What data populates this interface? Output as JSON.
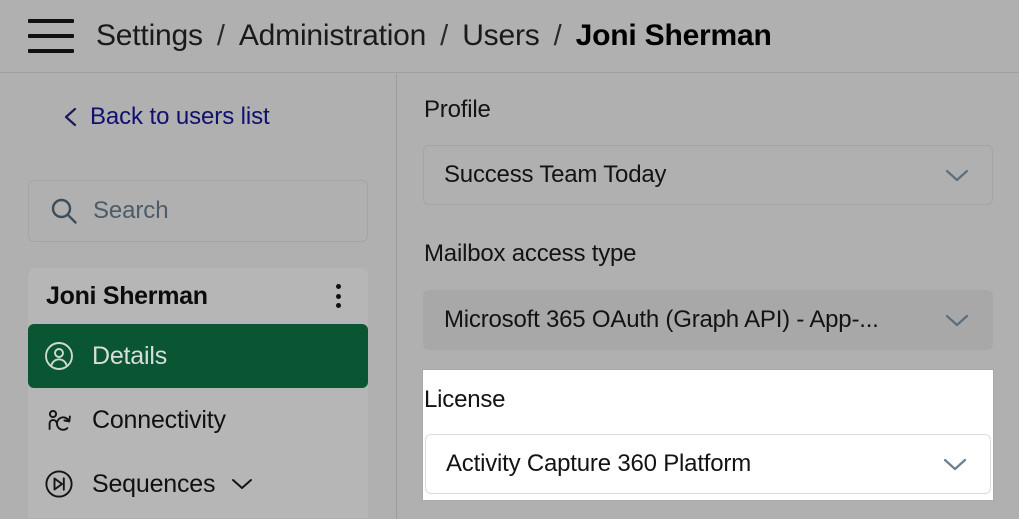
{
  "topbar": {
    "menu_icon": "hamburger-icon",
    "breadcrumbs": [
      {
        "label": "Settings",
        "current": false
      },
      {
        "label": "Administration",
        "current": false
      },
      {
        "label": "Users",
        "current": false
      },
      {
        "label": "Joni Sherman",
        "current": true
      }
    ],
    "separator": "/"
  },
  "sidebar": {
    "back_link": {
      "label": "Back to users list",
      "icon": "chevron-left-icon",
      "color": "#10106e"
    },
    "search": {
      "placeholder": "Search",
      "icon": "search-icon",
      "value": ""
    },
    "user": {
      "name": "Joni Sherman",
      "menu_icon": "kebab-menu-icon"
    },
    "nav_items": [
      {
        "label": "Details",
        "icon": "user-circle-icon",
        "active": true,
        "expandable": false
      },
      {
        "label": "Connectivity",
        "icon": "user-sync-icon",
        "active": false,
        "expandable": false
      },
      {
        "label": "Sequences",
        "icon": "play-skip-circle-icon",
        "active": false,
        "expandable": true
      }
    ],
    "active_color": "#0a5532"
  },
  "main": {
    "fields": [
      {
        "label": "Profile",
        "value": "Success Team Today",
        "style": "outlined",
        "chevron": "chevron-down-icon"
      },
      {
        "label": "Mailbox access type",
        "value": "Microsoft 365 OAuth (Graph API) - App-...",
        "style": "filled",
        "chevron": "chevron-down-icon"
      },
      {
        "label": "License",
        "value": "Activity Capture 360 Platform",
        "style": "onwhite",
        "chevron": "chevron-down-icon",
        "highlighted": true
      }
    ]
  }
}
